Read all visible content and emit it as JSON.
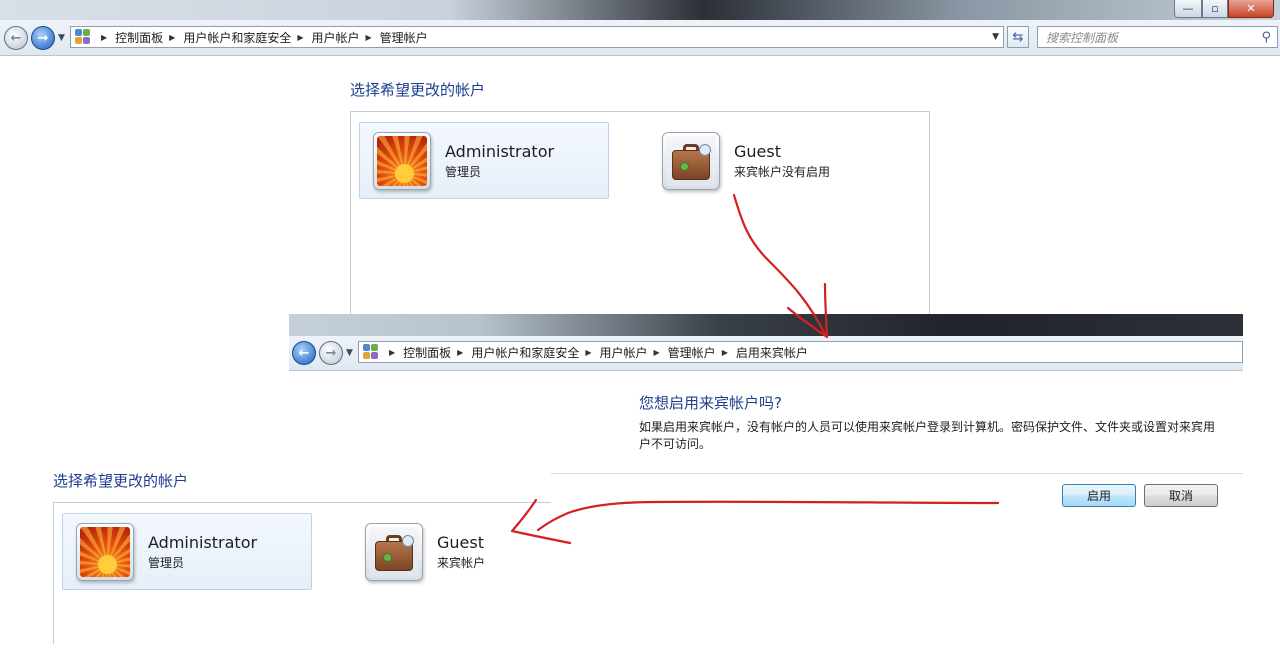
{
  "window_top": {
    "controls": {
      "minimize": "—",
      "maximize": "▫",
      "close": "✕"
    },
    "nav": {
      "back_icon": "back-arrow-icon",
      "forward_icon": "forward-arrow-icon",
      "breadcrumb": [
        "控制面板",
        "用户帐户和家庭安全",
        "用户帐户",
        "管理帐户"
      ],
      "search_placeholder": "搜索控制面板"
    },
    "heading": "选择希望更改的帐户",
    "accounts": [
      {
        "name": "Administrator",
        "role": "管理员",
        "icon": "flower-avatar",
        "selected": true
      },
      {
        "name": "Guest",
        "role": "来宾帐户没有启用",
        "icon": "suitcase-avatar",
        "selected": false
      }
    ]
  },
  "window_dialog": {
    "breadcrumb": [
      "控制面板",
      "用户帐户和家庭安全",
      "用户帐户",
      "管理帐户",
      "启用来宾帐户"
    ],
    "question": "您想启用来宾帐户吗?",
    "description_line1": "如果启用来宾帐户，没有帐户的人员可以使用来宾帐户登录到计算机。密码保护文件、文件夹或设置对来宾用",
    "description_line2": "户不可访问。",
    "buttons": {
      "enable": "启用",
      "cancel": "取消"
    }
  },
  "window_bottom": {
    "heading": "选择希望更改的帐户",
    "accounts": [
      {
        "name": "Administrator",
        "role": "管理员",
        "icon": "flower-avatar",
        "selected": true
      },
      {
        "name": "Guest",
        "role": "来宾帐户",
        "icon": "suitcase-avatar",
        "selected": false
      }
    ]
  },
  "annotation": {
    "arrow_color": "#d42020"
  }
}
